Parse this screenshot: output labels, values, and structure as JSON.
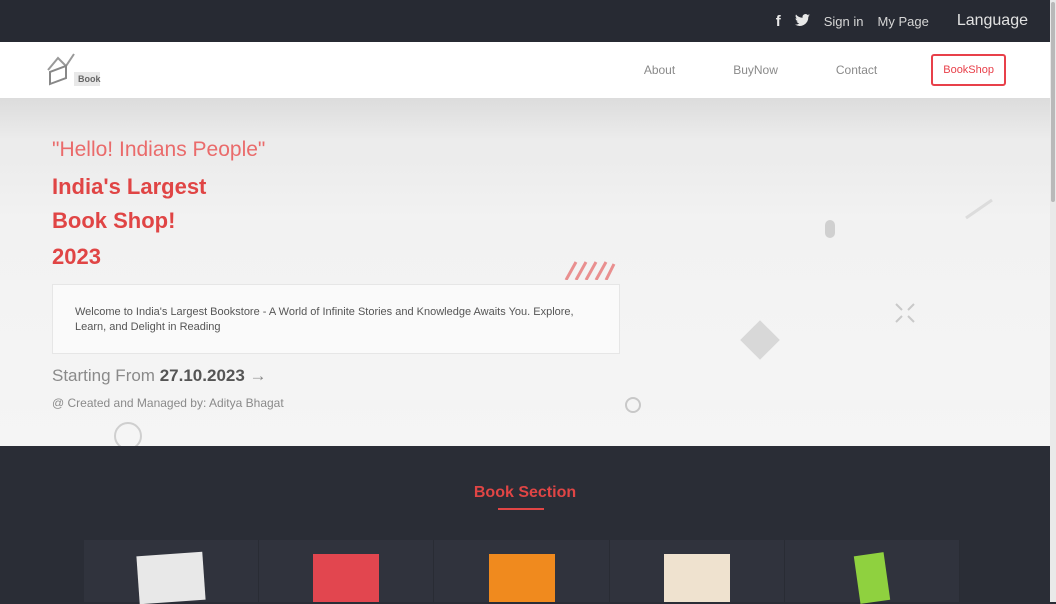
{
  "topbar": {
    "facebook_icon": "f",
    "twitter_icon": "t",
    "sign_in": "Sign in",
    "my_page": "My Page",
    "language": "Language"
  },
  "nav": {
    "logo_text": "Book",
    "links": [
      "About",
      "BuyNow",
      "Contact"
    ],
    "button": "BookShop"
  },
  "hero": {
    "hello": "\"Hello! Indians People\"",
    "line1": "India's Largest",
    "line2": "Book Shop!",
    "line3": "2023",
    "welcome": "Welcome to India's Largest Bookstore - A World of Infinite Stories and Knowledge Awaits You. Explore, Learn, and Delight in Reading",
    "starting_label": "Starting From",
    "starting_date": "27.10.2023",
    "credit": "@ Created and Managed by: Aditya Bhagat"
  },
  "section": {
    "title": "Book Section"
  },
  "colors": {
    "accent": "#e04545",
    "dark": "#2a2d36"
  }
}
